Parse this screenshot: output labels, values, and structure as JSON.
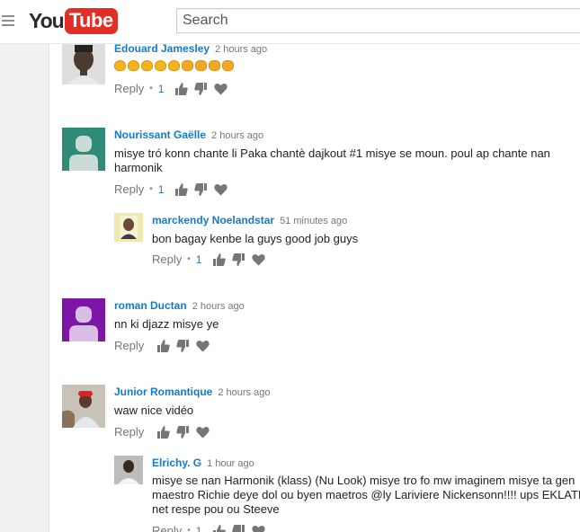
{
  "header": {
    "logo_you": "You",
    "logo_tube": "Tube",
    "search_placeholder": "Search"
  },
  "comments": [
    {
      "author": "Edouard Jamesley",
      "time": "2 hours ago",
      "emoji": [
        "clapping-hands",
        "clapping-hands",
        "clapping-hands",
        "clapping-hands",
        "clapping-hands",
        "fist-bump",
        "fist-bump",
        "fist-bump",
        "fist-bump"
      ],
      "reply_label": "Reply",
      "likes": "1"
    },
    {
      "author": "Nourissant Gaëlle",
      "time": "2 hours ago",
      "text_lines": [
        "misye tró konn chante li Paka chantè dajkout #1 misye se moun. poul ap chante nan",
        "harmonik"
      ],
      "reply_label": "Reply",
      "likes": "1",
      "avatar_color": "#2f8a78"
    },
    {
      "author": "marckendy Noelandstar",
      "time": "51 minutes ago",
      "text_lines": [
        "bon bagay kenbe la guys good job guys"
      ],
      "reply_label": "Reply",
      "likes": "1"
    },
    {
      "author": "roman Ductan",
      "time": "2 hours ago",
      "text_lines": [
        "nn ki djazz misye ye"
      ],
      "reply_label": "Reply",
      "avatar_color": "#7b16a6"
    },
    {
      "author": "Junior Romantique",
      "time": "2 hours ago",
      "text_lines": [
        "waw nice vidéo"
      ],
      "reply_label": "Reply"
    },
    {
      "author": "Elrichy. G",
      "time": "1 hour ago",
      "text_lines": [
        "misye se nan Harmonik (klass)   (Nu Look) misye tro fo mw imaginem misye ta gen",
        "maestro Richie deye dol ou byen maetros @ly Lariviere Nickensonn!!!! ups EKLATE",
        "net respe pou ou Steeve"
      ],
      "reply_label": "Reply",
      "likes": "1"
    }
  ]
}
